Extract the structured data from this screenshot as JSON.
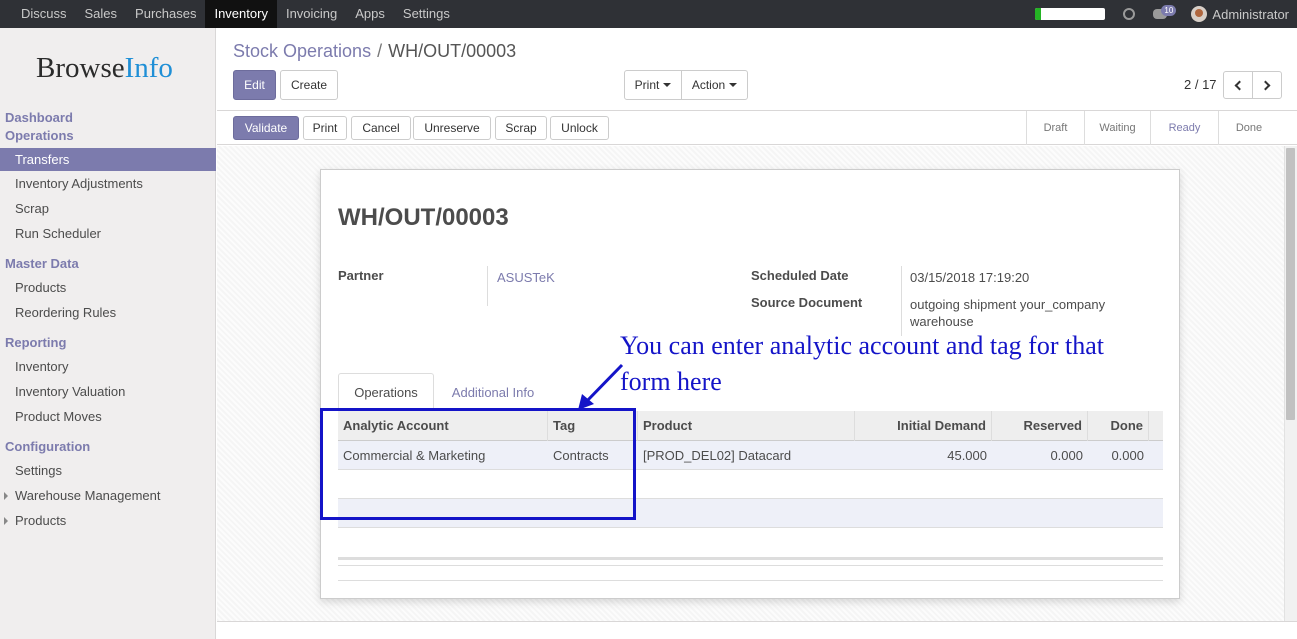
{
  "topbar": {
    "menu": [
      "Discuss",
      "Sales",
      "Purchases",
      "Inventory",
      "Invoicing",
      "Apps",
      "Settings"
    ],
    "active_menu": "Inventory",
    "progress_fraction": 0.08,
    "chat_badge": "10",
    "user": "Administrator",
    "colors": {
      "bar": "#2f3136",
      "progress": "#24b324"
    }
  },
  "sidebar": {
    "logo_part1": "Browse",
    "logo_part2": "Info",
    "sections": [
      {
        "title": "Dashboard Operations",
        "title_line1": "Dashboard",
        "title_line2": "Operations",
        "items": [
          "Transfers",
          "Inventory Adjustments",
          "Scrap",
          "Run Scheduler"
        ]
      },
      {
        "title": "Master Data",
        "items": [
          "Products",
          "Reordering Rules"
        ]
      },
      {
        "title": "Reporting",
        "items": [
          "Inventory",
          "Inventory Valuation",
          "Product Moves"
        ]
      },
      {
        "title": "Configuration",
        "items": [
          "Settings",
          "Warehouse Management",
          "Products"
        ]
      }
    ],
    "active_item": "Transfers",
    "accent": "#7c7bad"
  },
  "control_panel": {
    "breadcrumb_parent": "Stock Operations",
    "breadcrumb_sep": "/",
    "breadcrumb_current": "WH/OUT/00003",
    "edit_label": "Edit",
    "create_label": "Create",
    "print_label": "Print",
    "action_label": "Action",
    "pager": "2 / 17"
  },
  "status_bar": {
    "buttons": [
      "Validate",
      "Print",
      "Cancel",
      "Unreserve",
      "Scrap",
      "Unlock"
    ],
    "stages": [
      "Draft",
      "Waiting",
      "Ready",
      "Done"
    ],
    "active_stage": "Ready"
  },
  "form": {
    "name": "WH/OUT/00003",
    "partner_label": "Partner",
    "partner_value": "ASUSTeK",
    "scheduled_date_label": "Scheduled Date",
    "scheduled_date_value": "03/15/2018 17:19:20",
    "source_document_label": "Source Document",
    "source_document_line1": "outgoing shipment your_company",
    "source_document_line2": "warehouse",
    "tabs": [
      "Operations",
      "Additional Info"
    ],
    "active_tab": "Operations",
    "table": {
      "columns": [
        "Analytic Account",
        "Tag",
        "Product",
        "Initial Demand",
        "Reserved",
        "Done"
      ],
      "rows": [
        [
          "Commercial & Marketing",
          "Contracts",
          "[PROD_DEL02] Datacard",
          "45.000",
          "0.000",
          "0.000"
        ]
      ]
    }
  },
  "annotation": {
    "line1": "You can enter analytic account and tag for that",
    "line2": "form here",
    "color": "#1414c8"
  }
}
